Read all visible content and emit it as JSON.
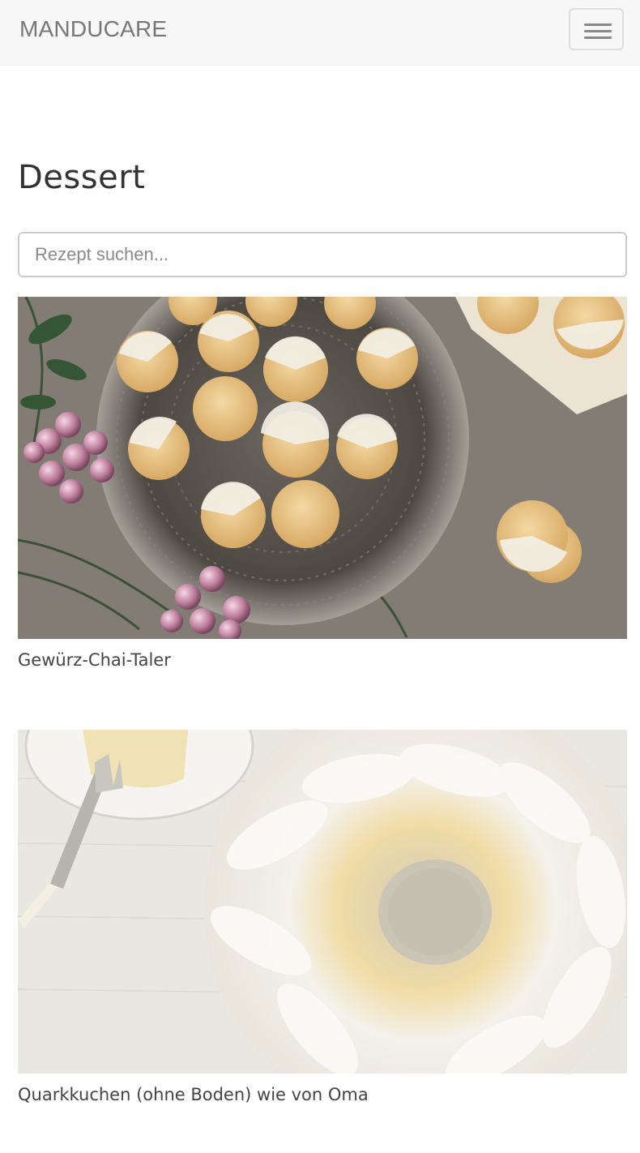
{
  "navbar": {
    "brand": "MANDUCARE",
    "menu_icon": "hamburger-menu-icon"
  },
  "page": {
    "title": "Dessert"
  },
  "search": {
    "placeholder": "Rezept suchen..."
  },
  "recipes": [
    {
      "title": "Gewürz-Chai-Taler",
      "image": "spiced chai cookies on silver tray photo"
    },
    {
      "title": "Quarkkuchen (ohne Boden) wie von Oma",
      "image": "powdered bundt cake photo"
    }
  ]
}
